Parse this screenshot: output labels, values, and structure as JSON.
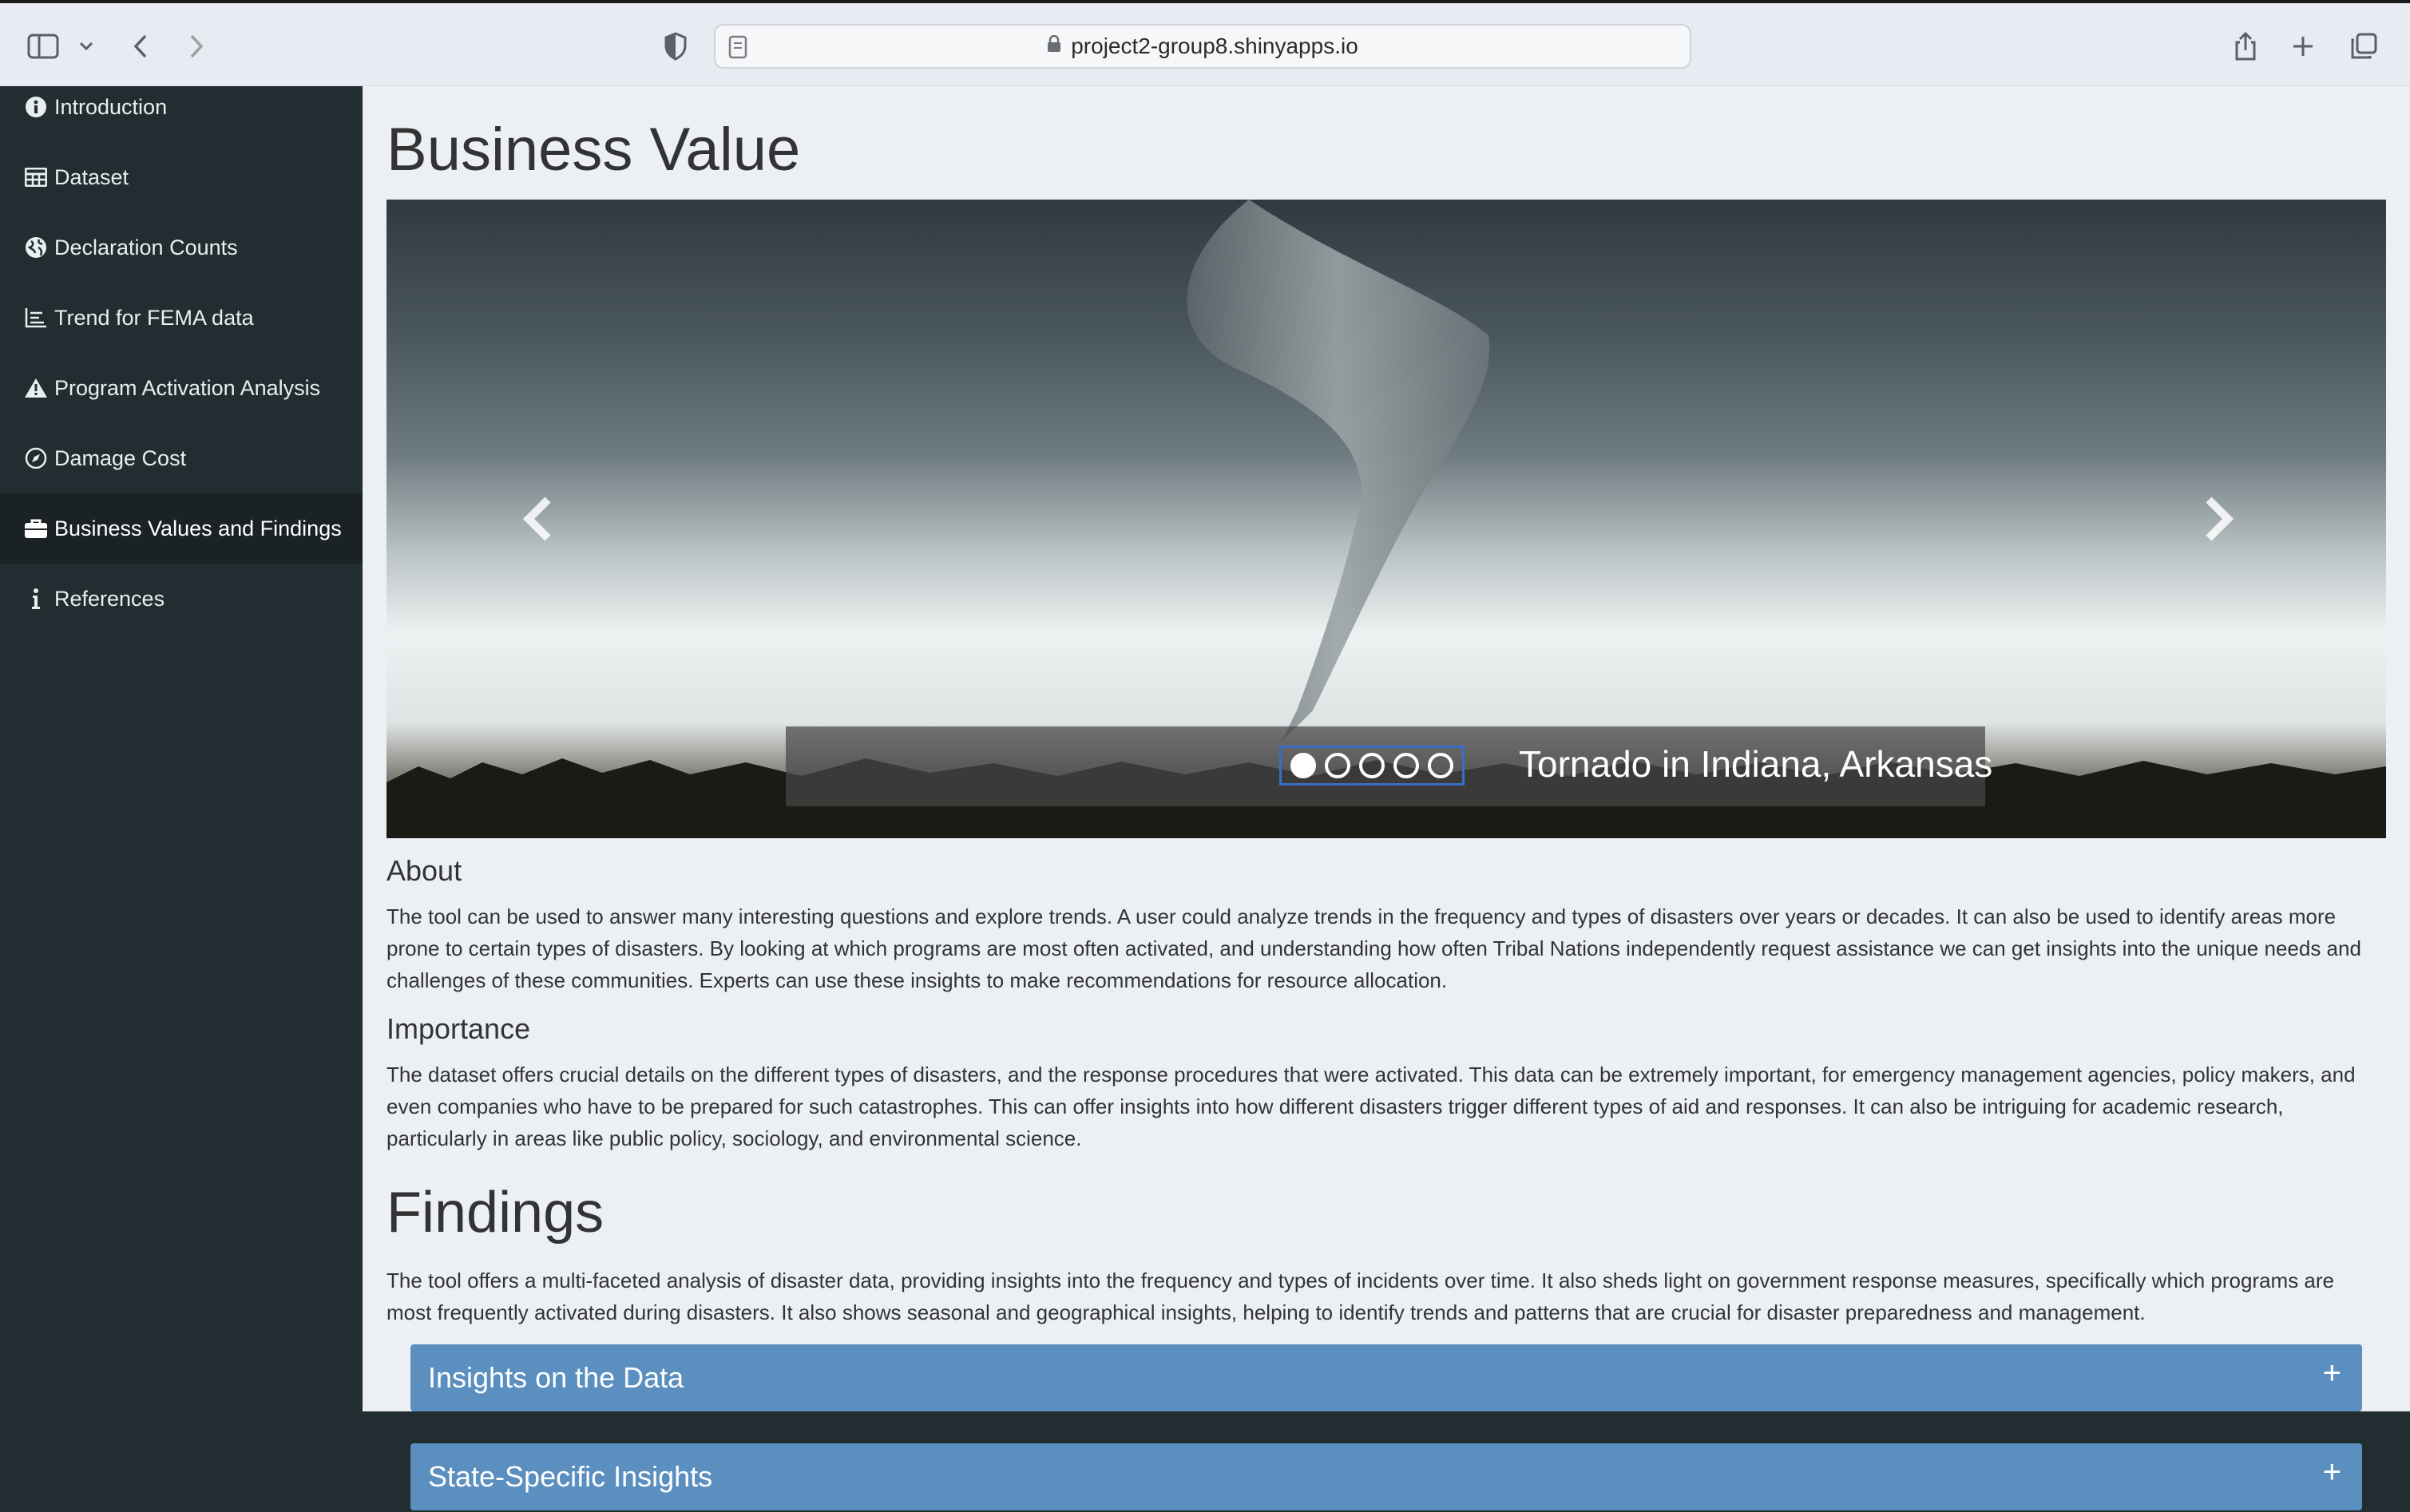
{
  "browser": {
    "url": "project2-group8.shinyapps.io"
  },
  "sidebar": {
    "items": [
      {
        "label": "Introduction",
        "icon": "info-circle-icon"
      },
      {
        "label": "Dataset",
        "icon": "table-icon"
      },
      {
        "label": "Declaration Counts",
        "icon": "globe-icon"
      },
      {
        "label": "Trend for FEMA data",
        "icon": "line-chart-icon"
      },
      {
        "label": "Program Activation Analysis",
        "icon": "warning-icon"
      },
      {
        "label": "Damage Cost",
        "icon": "compass-icon"
      },
      {
        "label": "Business Values and Findings",
        "icon": "briefcase-icon",
        "active": true
      },
      {
        "label": "References",
        "icon": "info-icon"
      }
    ]
  },
  "main": {
    "title": "Business Value",
    "carousel": {
      "caption": "Tornado in Indiana, Arkansas",
      "slide_count": 5,
      "active_index": 0
    },
    "about": {
      "heading": "About",
      "text": "The tool can be used to answer many interesting questions and explore trends. A user could analyze trends in the frequency and types of disasters over years or decades. It can also be used to identify areas more prone to certain types of disasters. By looking at which programs are most often activated, and understanding how often Tribal Nations independently request assistance we can get insights into the unique needs and challenges of these communities. Experts can use these insights to make recommendations for resource allocation."
    },
    "importance": {
      "heading": "Importance",
      "text": "The dataset offers crucial details on the different types of disasters, and the response procedures that were activated. This data can be extremely important, for emergency management agencies, policy makers, and even companies who have to be prepared for such catastrophes. This can offer insights into how different disasters trigger different types of aid and responses. It can also be intriguing for academic research, particularly in areas like public policy, sociology, and environmental science."
    },
    "findings": {
      "heading": "Findings",
      "text": "The tool offers a multi-faceted analysis of disaster data, providing insights into the frequency and types of incidents over time. It also sheds light on government response measures, specifically which programs are most frequently activated during disasters. It also shows seasonal and geographical insights, helping to identify trends and patterns that are crucial for disaster preparedness and management."
    },
    "accordions": [
      {
        "label": "Insights on the Data",
        "icon": "plus-icon"
      },
      {
        "label": "State-Specific Insights",
        "icon": "plus-icon"
      }
    ]
  },
  "colors": {
    "sidebar_bg": "#222d32",
    "sidebar_active_bg": "#1a2226",
    "content_bg": "#ecf0f5",
    "accordion_bg": "#5a8fc0"
  }
}
